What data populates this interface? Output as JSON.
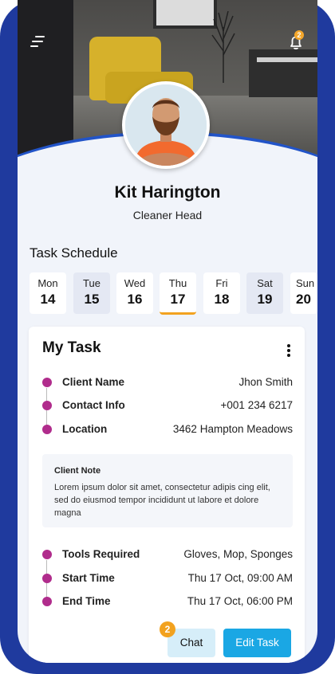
{
  "header": {
    "menu_icon": "menu-icon",
    "notification_icon": "bell-icon",
    "notification_count": "2"
  },
  "profile": {
    "name": "Kit Harington",
    "role": "Cleaner Head"
  },
  "schedule": {
    "title": "Task Schedule",
    "days": [
      {
        "name": "Mon",
        "date": "14"
      },
      {
        "name": "Tue",
        "date": "15"
      },
      {
        "name": "Wed",
        "date": "16"
      },
      {
        "name": "Thu",
        "date": "17"
      },
      {
        "name": "Fri",
        "date": "18"
      },
      {
        "name": "Sat",
        "date": "19"
      },
      {
        "name": "Sun",
        "date": "20"
      }
    ]
  },
  "task": {
    "title": "My Task",
    "client_name_label": "Client Name",
    "client_name": "Jhon Smith",
    "contact_label": "Contact Info",
    "contact": "+001 234 6217",
    "location_label": "Location",
    "location": "3462 Hampton Meadows",
    "note_title": "Client Note",
    "note_text": "Lorem ipsum dolor sit amet, consectetur adipis cing elit, sed do eiusmod tempor incididunt ut labore et dolore magna",
    "tools_label": "Tools Required",
    "tools": "Gloves, Mop, Sponges",
    "start_label": "Start Time",
    "start": "Thu 17 Oct, 09:00 AM",
    "end_label": "End Time",
    "end": "Thu 17 Oct, 06:00 PM"
  },
  "actions": {
    "chat_label": "Chat",
    "chat_badge": "2",
    "edit_label": "Edit Task"
  },
  "colors": {
    "frame": "#1f3a9e",
    "accent": "#1aa7e4",
    "dot": "#b02c8c",
    "highlight": "#f2a21f"
  }
}
